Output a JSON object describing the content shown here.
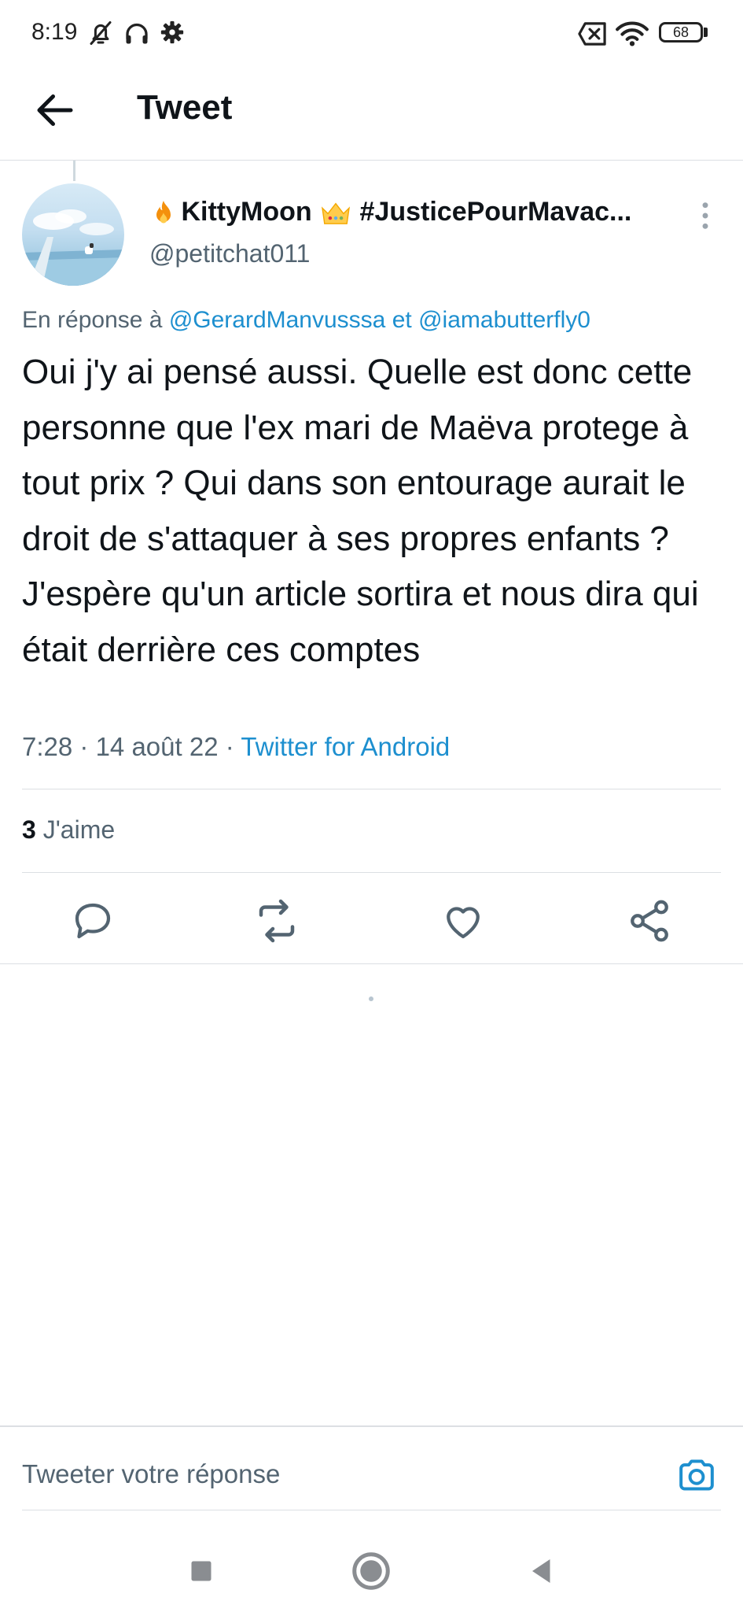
{
  "status_bar": {
    "time": "8:19",
    "battery": "68",
    "icons": [
      "muted-bell-icon",
      "headphones-icon",
      "gear-icon",
      "no-sim-icon",
      "wifi-icon",
      "battery-icon"
    ]
  },
  "header": {
    "title": "Tweet",
    "back_icon": "arrow-left-icon"
  },
  "tweet": {
    "display_name": "KittyMoon",
    "name_hashtag": "#JusticePourMavac...",
    "name_emojis": [
      "fire-emoji",
      "crown-emoji"
    ],
    "handle": "@petitchat011",
    "reply_prefix": "En réponse à",
    "reply_mention_1": "@GerardManvusssa",
    "reply_conjunction": "et",
    "reply_mention_2": "@iamabutterfly0",
    "text": "Oui j'y ai pensé aussi. Quelle est donc cette personne que l'ex mari de Maëva protege à tout prix ? Qui dans son entourage aurait le droit de s'attaquer à ses propres enfants ? J'espère qu'un article sortira et nous dira qui était derrière ces comptes",
    "time": "7:28",
    "date": "14 août 22",
    "separator": "·",
    "source": "Twitter for Android",
    "likes_count": "3",
    "likes_label": "J'aime"
  },
  "actions": {
    "reply_icon": "reply-bubble-icon",
    "retweet_icon": "retweet-icon",
    "like_icon": "heart-icon",
    "share_icon": "share-icon"
  },
  "reply_bar": {
    "placeholder": "Tweeter votre réponse",
    "camera_icon": "camera-icon"
  },
  "nav_bar": {
    "icons": [
      "recent-apps-icon",
      "home-icon",
      "back-triangle-icon"
    ]
  },
  "colors": {
    "link": "#1d8fcf",
    "muted_text": "#536471",
    "primary_text": "#0f1419",
    "divider": "#dcdfe3",
    "background": "#ffffff"
  }
}
